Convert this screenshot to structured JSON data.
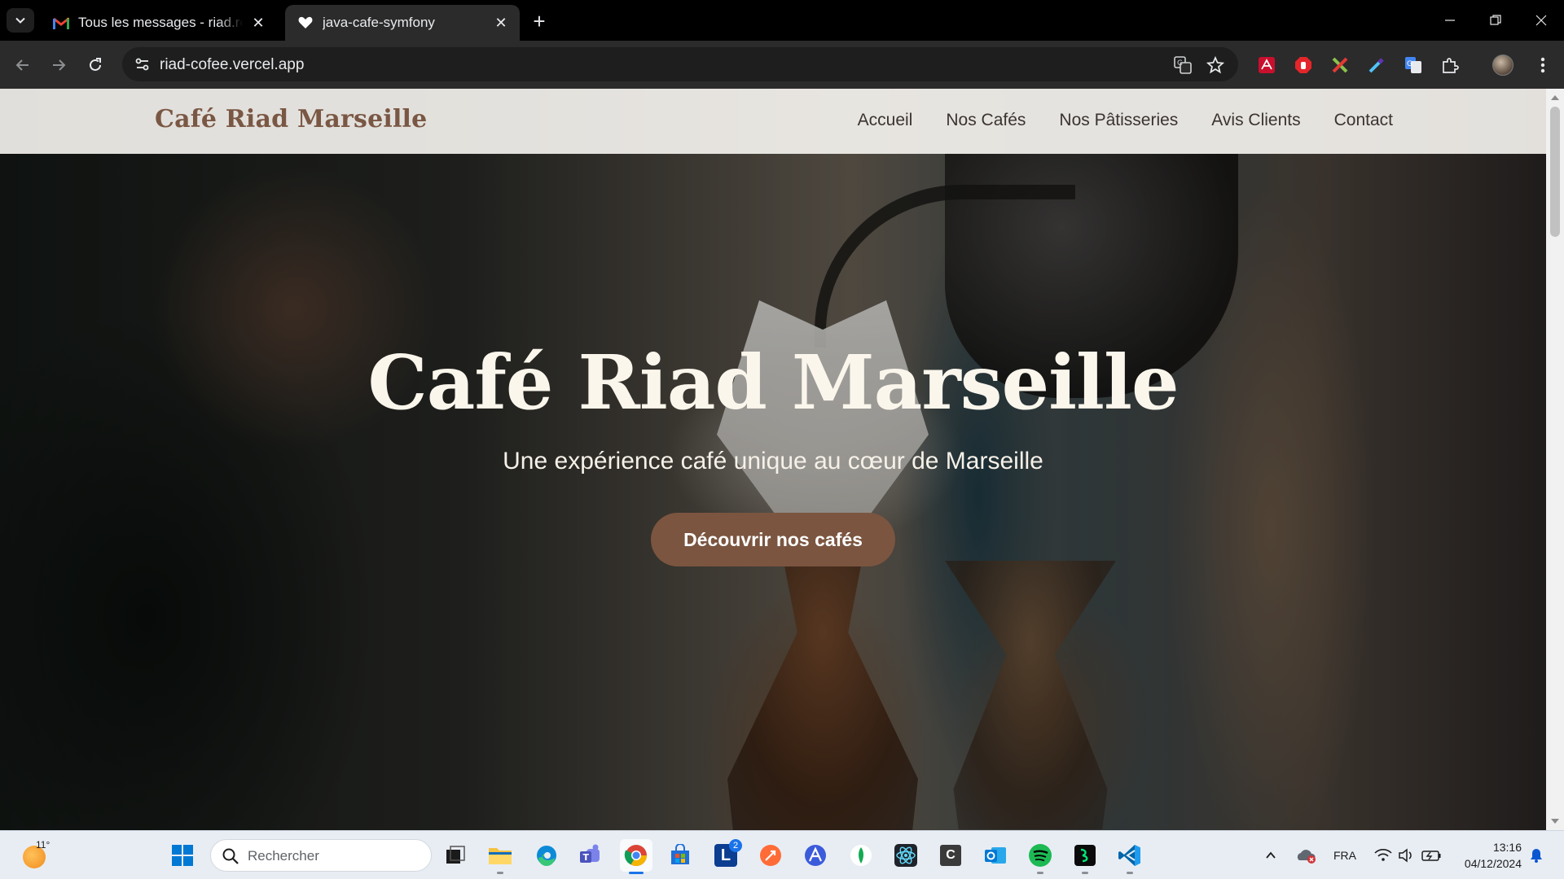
{
  "browser": {
    "tabs": [
      {
        "title": "Tous les messages - riad.reda.fe",
        "icon": "gmail-icon",
        "active": false
      },
      {
        "title": "java-cafe-symfony",
        "icon": "heart-icon",
        "active": true
      }
    ],
    "url": "riad-cofee.vercel.app"
  },
  "site": {
    "logo": "Café Riad Marseille",
    "nav": [
      "Accueil",
      "Nos Cafés",
      "Nos Pâtisseries",
      "Avis Clients",
      "Contact"
    ],
    "hero": {
      "title": "Café Riad Marseille",
      "subtitle": "Une expérience café unique au cœur de Marseille",
      "cta": "Découvrir nos cafés"
    },
    "colors": {
      "brand": "#7b5540",
      "header_bg": "#f8f6f2",
      "title_color": "#fbf6ec"
    }
  },
  "taskbar": {
    "weather_temp": "11°",
    "search_placeholder": "Rechercher",
    "apps": [
      "task-view",
      "file-explorer",
      "edge",
      "teams",
      "chrome",
      "microsoft-store",
      "l-app",
      "postman",
      "arc-app",
      "mongodb-compass",
      "react-devtools",
      "c-app",
      "outlook",
      "spotify",
      "git-app",
      "vscode"
    ],
    "l_app_badge": "2",
    "language": "FRA",
    "time": "13:16",
    "date": "04/12/2024"
  }
}
